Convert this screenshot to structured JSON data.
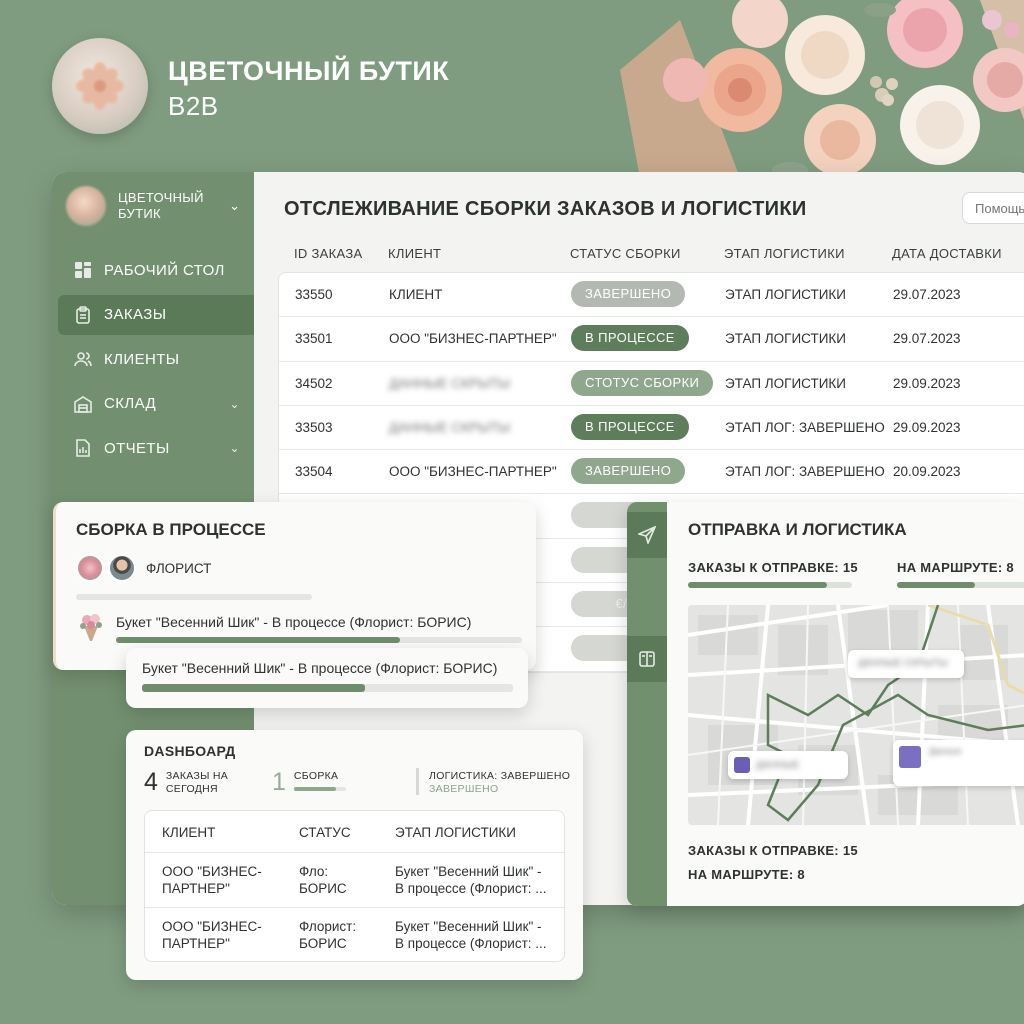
{
  "hero": {
    "title": "ЦВЕТОЧНЫЙ БУТИК",
    "subtitle": "B2B"
  },
  "sidebar": {
    "brand": "ЦВЕТОЧНЫЙ\nБУТИК",
    "items": [
      {
        "label": "РАБОЧИЙ СТОЛ",
        "icon": "dashboard-icon",
        "active": false
      },
      {
        "label": "ЗАКАЗЫ",
        "icon": "clipboard-icon",
        "active": true
      },
      {
        "label": "КЛИЕНТЫ",
        "icon": "users-icon",
        "active": false
      },
      {
        "label": "СКЛАД",
        "icon": "warehouse-icon",
        "active": false
      },
      {
        "label": "ОТЧЕТЫ",
        "icon": "report-icon",
        "active": false
      }
    ]
  },
  "main": {
    "title": "ОТСЛЕЖИВАНИЕ СБОРКИ ЗАКАЗОВ И ЛОГИСТИКИ",
    "search_placeholder": "Помощь",
    "columns": [
      "ID ЗАКАЗА",
      "КЛИЕНТ",
      "СТАТУС СБОРКИ",
      "ЭТАП ЛОГИСТИКИ",
      "ДАТА ДОСТАВКИ"
    ],
    "rows": [
      {
        "id": "33550",
        "client": "КЛИЕНТ",
        "status": "ЗАВЕРШЕНО",
        "logistics": "ЭТАП ЛОГИСТИКИ",
        "date": "29.07.2023"
      },
      {
        "id": "33501",
        "client": "ООО \"БИЗНЕС-ПАРТНЕР\"",
        "status": "В ПРОЦЕССЕ",
        "logistics": "ЭТАП ЛОГИСТИКИ",
        "date": "29.07.2023"
      },
      {
        "id": "34502",
        "client": "ДАННЫЕ СКРЫТЫ",
        "status": "СТОТУС СБОРКИ",
        "logistics": "ЭТАП ЛОГИСТИКИ",
        "date": "29.09.2023"
      },
      {
        "id": "33503",
        "client": "ДАННЫЕ СКРЫТЫ",
        "status": "В ПРОЦЕССЕ",
        "logistics": "ЭТАП ЛОГ: ЗАВЕРШЕНО",
        "date": "29.09.2023"
      },
      {
        "id": "33504",
        "client": "ООО \"БИЗНЕС-ПАРТНЕР\"",
        "status": "ЗАВЕРШЕНО",
        "logistics": "ЭТАП ЛОГ: ЗАВЕРШЕНО",
        "date": "20.09.2023"
      }
    ],
    "ghost_pill": "€/€"
  },
  "assembly": {
    "title": "СБОРКА В ПРОЦЕССЕ",
    "florist_label": "ФЛОРИСТ",
    "task": "Букет \"Весенний Шик\" - В процессе (Флорист: БОРИС)",
    "progress": 0.7
  },
  "task2": {
    "task": "Букет \"Весенний Шик\" - В процессе (Флорист: БОРИС)",
    "progress": 0.6
  },
  "dashboard": {
    "title": "DASHБОАРД",
    "stats": [
      {
        "num": "4",
        "label": "ЗАКАЗЫ НА\nСЕГОДНЯ"
      },
      {
        "num": "1",
        "label": "СБОРКА"
      },
      {
        "label": "ЛОГИСТИКА: ЗАВЕРШЕНО",
        "sub": "ЗАВЕРШЕНО"
      }
    ],
    "columns": [
      "КЛИЕНТ",
      "СТАТУС",
      "ЭТАП ЛОГИСТИКИ"
    ],
    "rows": [
      {
        "client": "ООО \"БИЗНЕС-\nПАРТНЕР\"",
        "status": "Фло:\nБОРИС",
        "stage": "Букет \"Весенний Шик\" -\nВ процессе (Флорист: ..."
      },
      {
        "client": "ООО \"БИЗНЕС-\nПАРТНЕР\"",
        "status": "Флорист:\nБОРИС",
        "stage": "Букет \"Весенний Шик\" -\nВ процессе (Флорист: ..."
      }
    ]
  },
  "logistics": {
    "title": "ОТПРАВКА И ЛОГИСТИКА",
    "to_ship": "ЗАКАЗЫ К ОТПРАВКЕ: 15",
    "en_route": "НА МАРШРУТЕ: 8",
    "to_ship_progress": 0.85,
    "en_route_progress": 0.6,
    "map_tags": [
      "ДАННЫЕ СКРЫТЫ",
      "ДАННЫЕ",
      "Данные"
    ]
  },
  "colors": {
    "bg": "#7f9c80",
    "sidebar": "#72906f",
    "accent": "#5e7d5b",
    "muted_pill": "#b3b8b2"
  }
}
